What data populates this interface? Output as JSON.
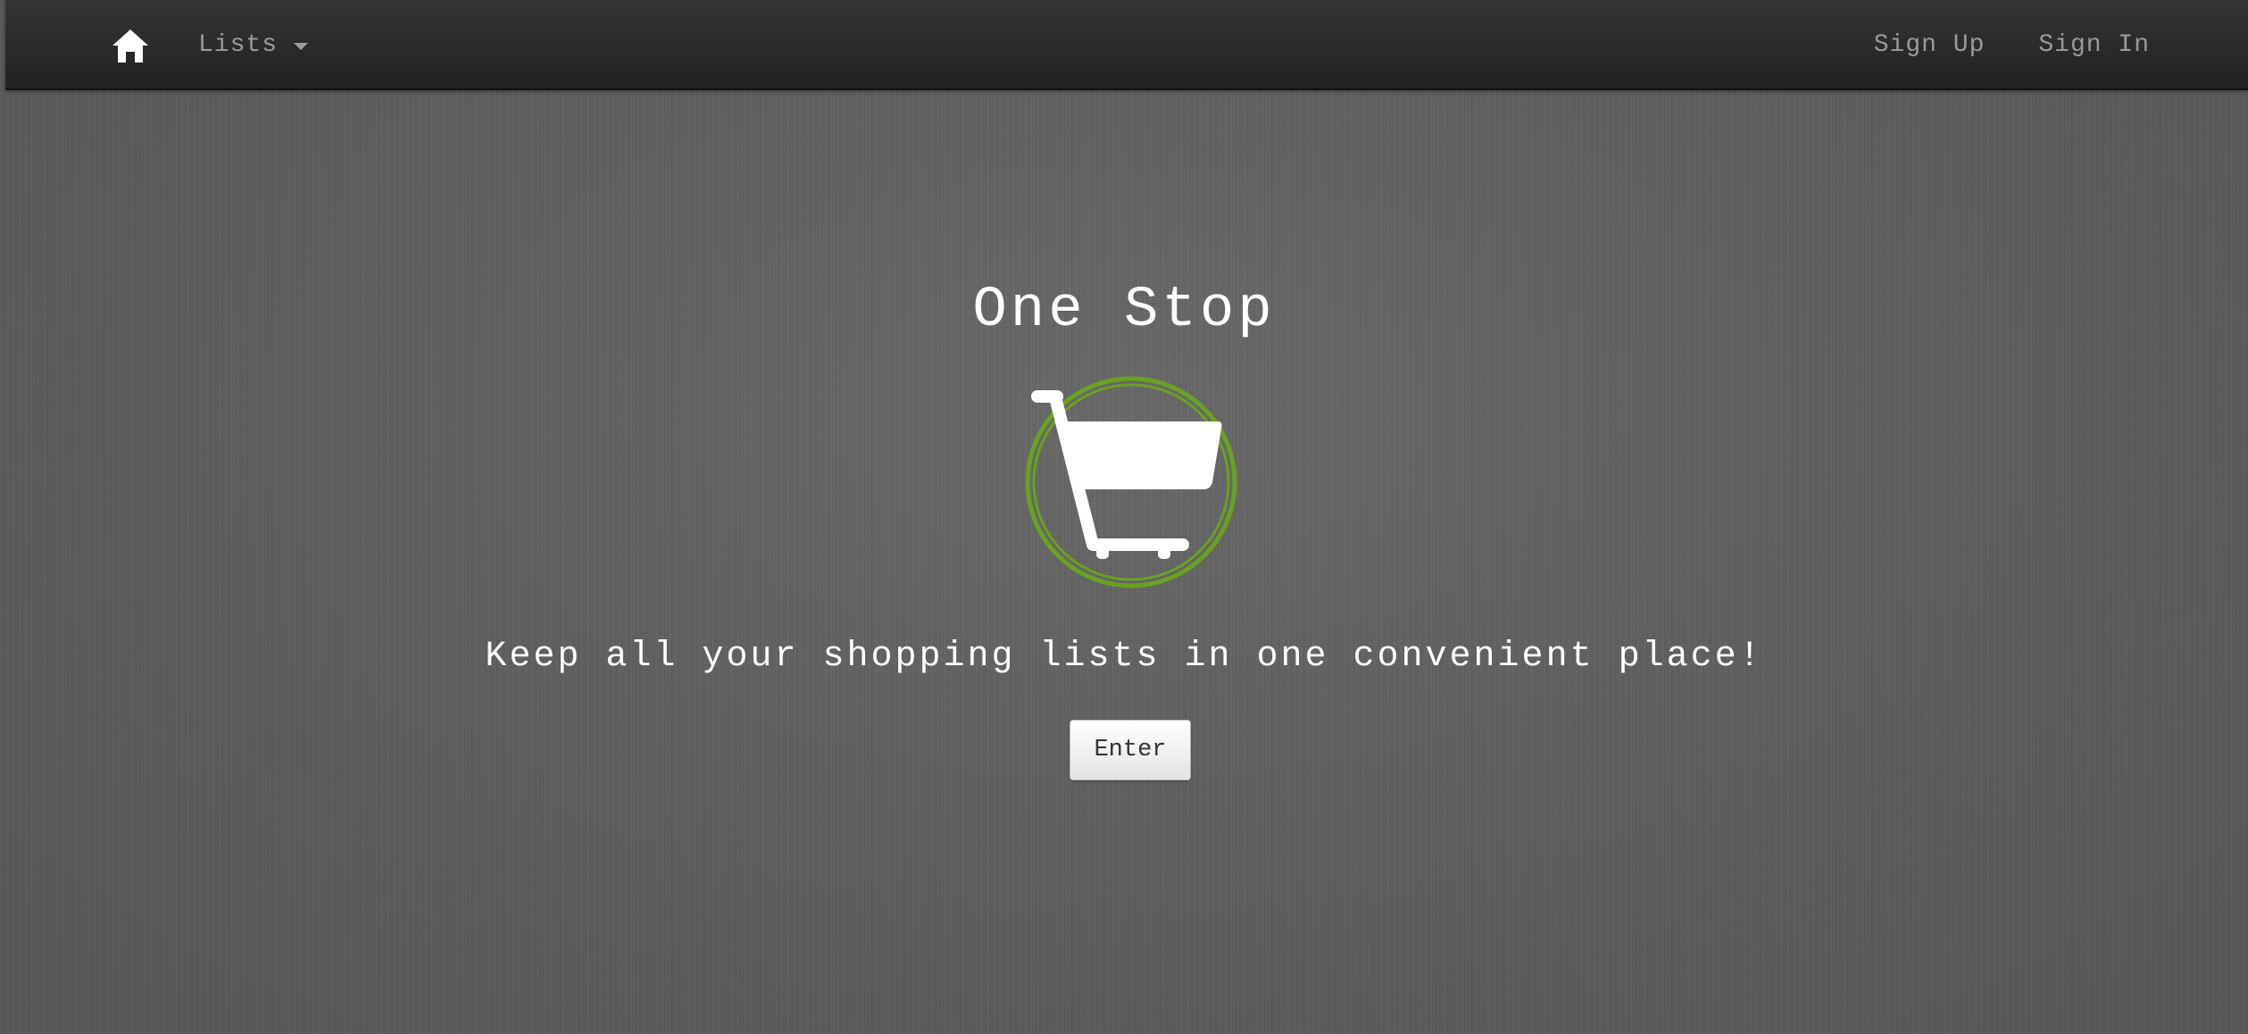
{
  "navbar": {
    "home_icon": "home-icon",
    "lists_label": "Lists",
    "lists_caret_icon": "caret-down-icon",
    "signup_label": "Sign Up",
    "signin_label": "Sign In"
  },
  "hero": {
    "title": "One Stop",
    "logo_icon": "shopping-cart-icon",
    "tagline": "Keep all your shopping lists in one convenient place!",
    "enter_label": "Enter"
  },
  "colors": {
    "background": "#5e5e5e",
    "navbar": "#2a2a2a",
    "nav_text": "#9a9a9a",
    "logo_ring": "#6aa121",
    "text": "#ffffff"
  }
}
